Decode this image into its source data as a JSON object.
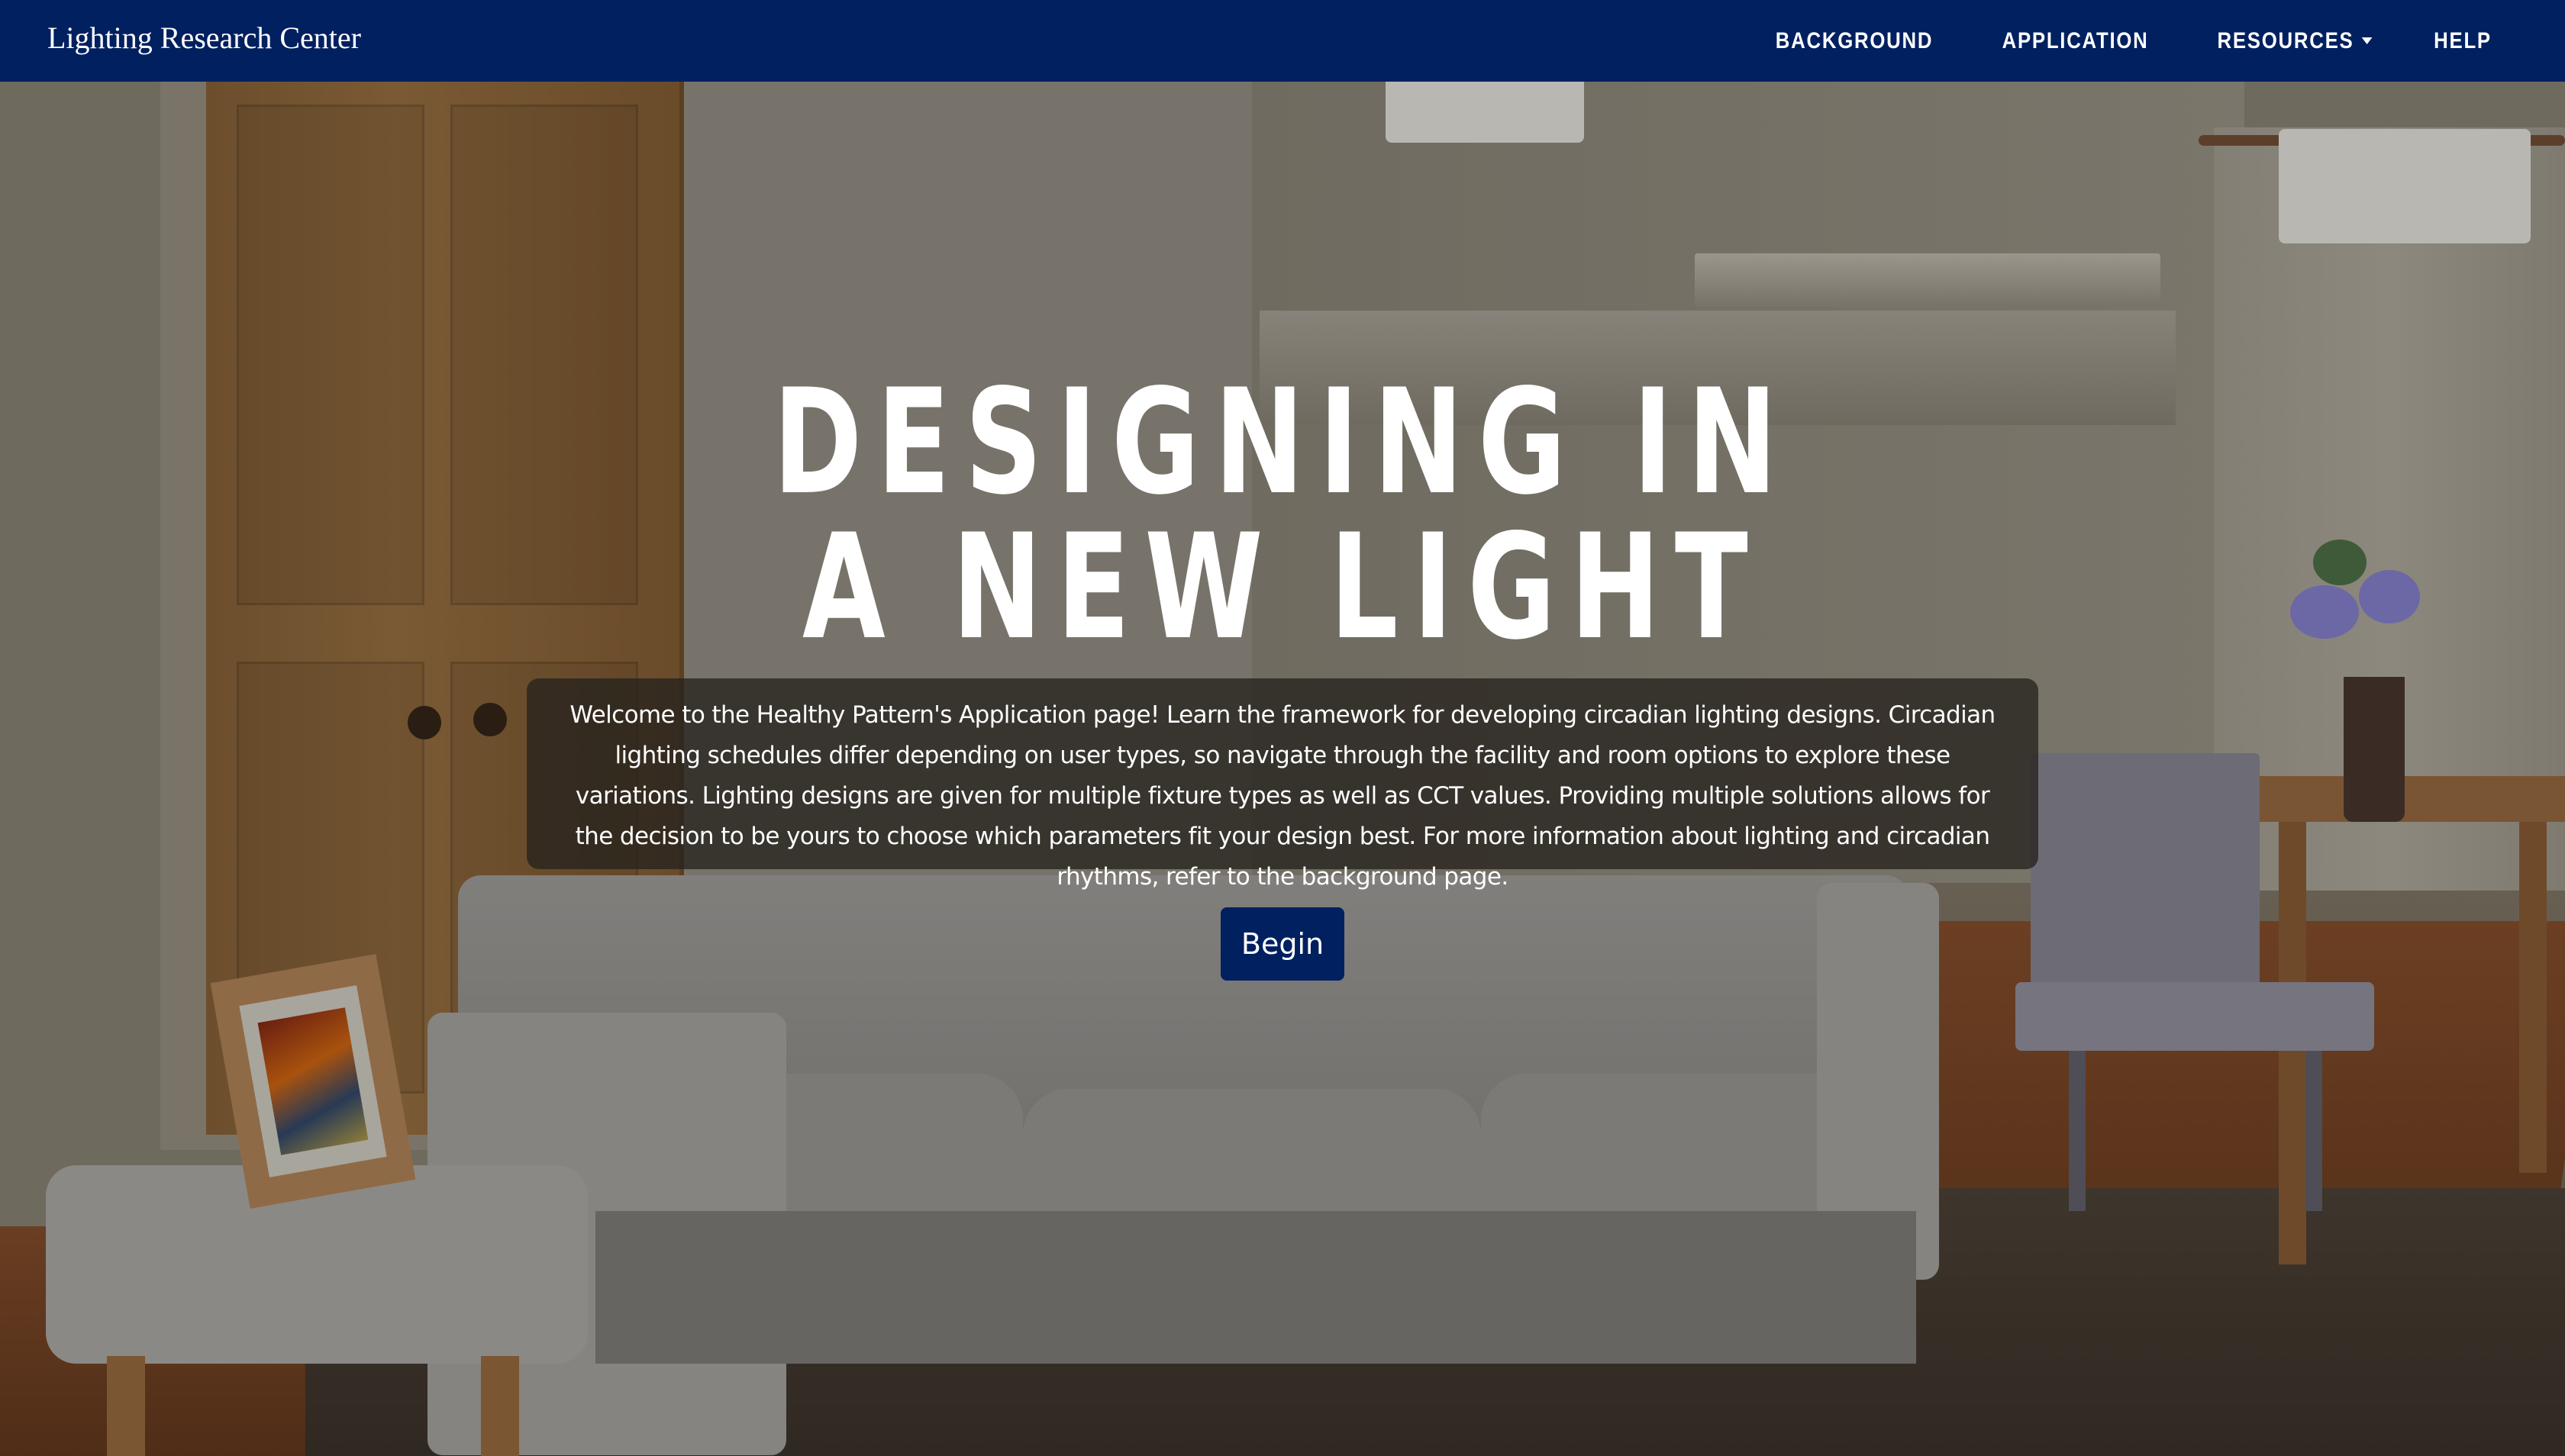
{
  "navbar": {
    "brand": "Lighting Research Center",
    "links": [
      {
        "label": "BACKGROUND"
      },
      {
        "label": "APPLICATION"
      },
      {
        "label": "RESOURCES"
      },
      {
        "label": "HELP"
      }
    ]
  },
  "hero": {
    "title_line1": "DESIGNING IN",
    "title_line2": "A NEW LIGHT",
    "intro_text": "Welcome to the Healthy Pattern's Application page! Learn the framework for developing circadian lighting designs. Circadian lighting schedules differ depending on user types, so navigate through the facility and room options to explore these variations. Lighting designs are given for multiple fixture types as well as CCT values. Providing multiple solutions allows for the decision to be yours to choose which parameters fit your design best. For more information about lighting and circadian rhythms, refer to the background page.",
    "begin_label": "Begin"
  },
  "colors": {
    "navbar_bg": "#002060",
    "button_bg": "#002060",
    "text": "#ffffff"
  },
  "icons": {
    "resources_dropdown": "caret-down-icon"
  }
}
